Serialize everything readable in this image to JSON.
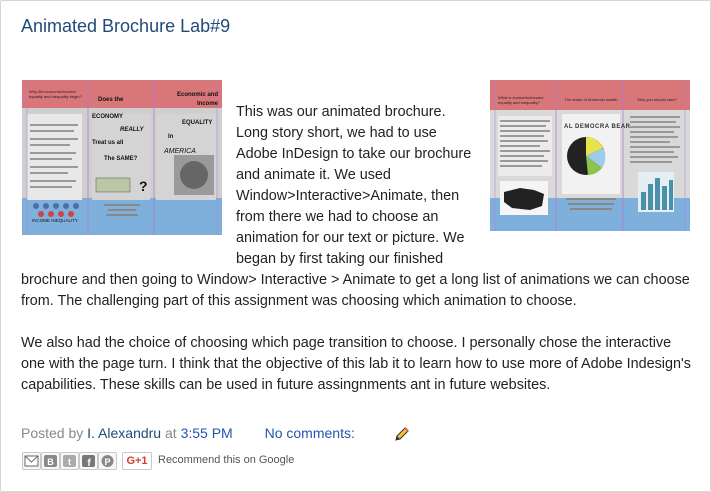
{
  "post": {
    "title": "Animated Brochure Lab#9",
    "paragraph1_float": "This was our animated brochure. Long story short, we had to use Adobe InDesign to take our brochure and animate it. We used Window>Interactive>Animate, then from there we had to choose an animation for our text or picture. We began by first taking our finished",
    "paragraph1_full": "brochure and then going to Window> Interactive > Animate to get a long list of animations we can choose from. The challenging part of this assignment was choosing which animation to choose.",
    "paragraph2": "We also had the choice of choosing which page transition to choose. I personally chose the interactive   one with the page turn. I think that the objective of this lab it to learn how to use more of Adobe Indesign's capabilities. These skills can be used in future assingnments ant in future websites."
  },
  "footer": {
    "posted_by_label": "Posted by",
    "author": "I. Alexandru",
    "at_label": "at",
    "time": "3:55 PM",
    "comments": "No comments:"
  },
  "share": {
    "buttons": [
      "email-icon",
      "blog-this-icon",
      "twitter-icon",
      "facebook-icon",
      "pinterest-icon"
    ],
    "gplus_label": "G+1",
    "recommend_text": "Recommend this on Google"
  },
  "brochure_left": {
    "col1_heading": "Why did economic/income equality and inequality begin?",
    "col2_line1": "Does the",
    "col2_line2": "ECONOMY",
    "col2_line3": "REALLY",
    "col2_line4": "Treat us all",
    "col2_line5": "The SAME?",
    "col3_line1": "Economic and Income",
    "col3_line2": "EQUALITY",
    "col3_line3": "In",
    "col3_line4": "AMERICA",
    "caption": "INCOME INEQUALITY"
  },
  "brochure_right": {
    "col1_heading": "What is economic/income equality and inequality?",
    "col2_heading": "The share of American wealth",
    "col3_heading": "Why you should care?",
    "chart_label": "AL DEMOCRA BEAR"
  },
  "colors": {
    "title": "#1f4a7a",
    "link": "#2255aa",
    "band_red": "#d9767a",
    "band_blue": "#7fb0dc",
    "panel_gray": "#d9d9d9"
  }
}
